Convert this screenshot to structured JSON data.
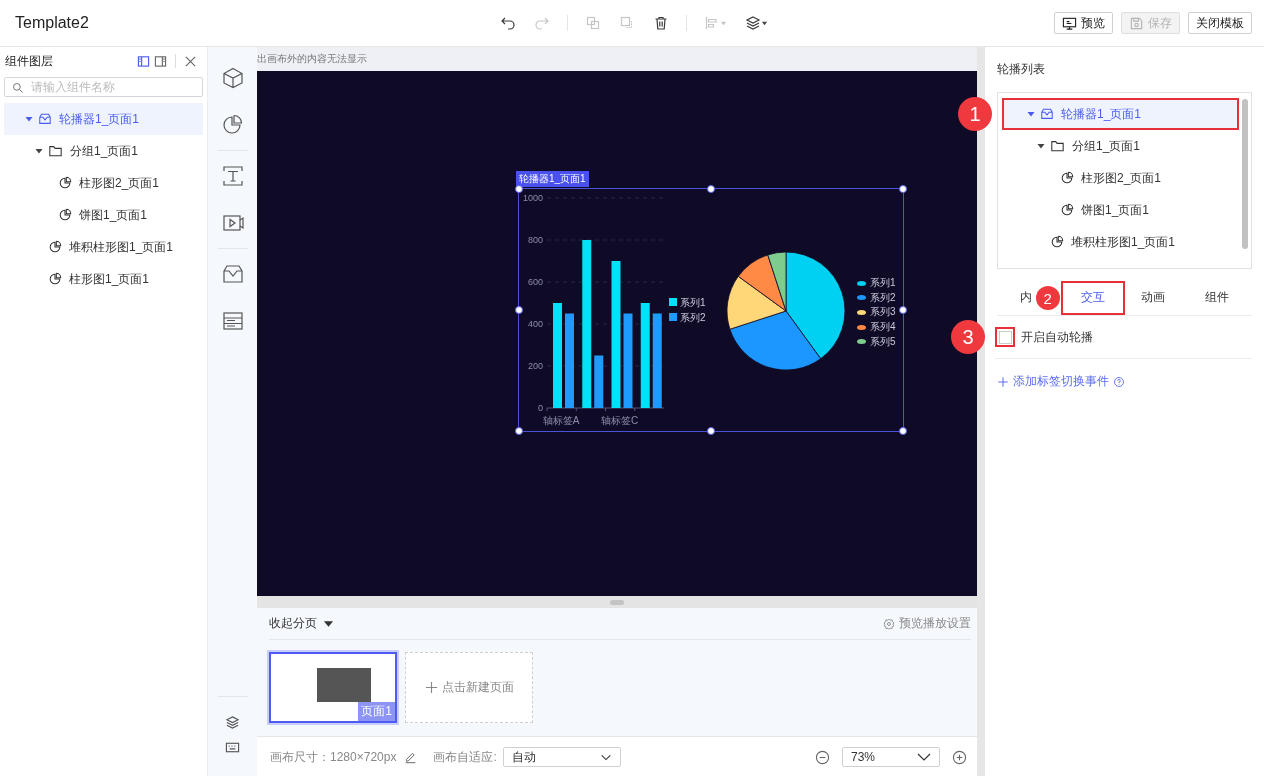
{
  "app_bar": {
    "title": "Template2",
    "toolbar": [
      {
        "kind": "undo",
        "disabled": false
      },
      {
        "kind": "redo",
        "disabled": true
      },
      {
        "kind": "separator"
      },
      {
        "kind": "copy",
        "disabled": true
      },
      {
        "kind": "duplicate",
        "disabled": true
      },
      {
        "kind": "delete",
        "disabled": false
      },
      {
        "kind": "separator"
      },
      {
        "kind": "align",
        "disabled": true
      },
      {
        "kind": "layer",
        "disabled": false
      }
    ],
    "buttons": [
      {
        "kind": "preview",
        "label": "预览",
        "disabled": false
      },
      {
        "kind": "save",
        "label": "保存",
        "disabled": true
      },
      {
        "kind": "close",
        "label": "关闭模板",
        "disabled": false
      }
    ]
  },
  "layers_panel": {
    "title": "组件图层",
    "search": {
      "placeholder": "请输入组件名称"
    },
    "tree": [
      {
        "label": "轮播器1_页面1",
        "kind": "carousel",
        "selected": true,
        "expanded": true,
        "children": [
          {
            "label": "分组1_页面1",
            "kind": "folder",
            "selected": false,
            "expanded": true,
            "children": [
              {
                "label": "柱形图2_页面1",
                "kind": "chart",
                "selected": false
              },
              {
                "label": "饼图1_页面1",
                "kind": "chart",
                "selected": false
              }
            ]
          },
          {
            "label": "堆积柱形图1_页面1",
            "kind": "chart",
            "selected": false
          },
          {
            "label": "柱形图1_页面1",
            "kind": "chart",
            "selected": false
          }
        ]
      }
    ]
  },
  "canvas": {
    "notice": "出画布外的内容无法显示",
    "widget": {
      "label": "轮播器1_页面1",
      "chart_data": {
        "type": "bar",
        "categories": [
          "轴标签A",
          null,
          "轴标签C",
          null
        ],
        "stacked": false,
        "grid": true,
        "legend": true,
        "ylim": [
          0,
          1000
        ],
        "yticks": [
          0,
          200,
          400,
          600,
          800,
          1000
        ],
        "series": [
          {
            "name": "系列1",
            "color": "#00e1fa",
            "values": [
              500,
              800,
              700,
              500
            ]
          },
          {
            "name": "系列2",
            "color": "#1e9bff",
            "values": [
              450,
              250,
              450,
              450
            ]
          }
        ]
      },
      "pie_legend": [
        {
          "label": "系列1",
          "color": "#00d0f2"
        },
        {
          "label": "系列2",
          "color": "#1b97ff"
        },
        {
          "label": "系列3",
          "color": "#ffd778"
        },
        {
          "label": "系列4",
          "color": "#ff8a45"
        },
        {
          "label": "系列5",
          "color": "#7fcc8f"
        }
      ]
    }
  },
  "pages": {
    "toggle": "收起分页",
    "settings": "预览播放设置",
    "items": [
      {
        "label": "页面1",
        "selected": true
      }
    ],
    "new_page": "点击新建页面"
  },
  "footer": {
    "size": "画布尺寸：1280×720px",
    "fit_label": "画布自适应:",
    "fit_value": "自动",
    "zoom": "73%"
  },
  "settings_panel": {
    "title": "轮播列表",
    "tree": [
      {
        "label": "轮播器1_页面1",
        "kind": "carousel",
        "selected": true,
        "expanded": true,
        "callout": "1",
        "children": [
          {
            "label": "分组1_页面1",
            "kind": "folder",
            "selected": false,
            "expanded": true,
            "children": [
              {
                "label": "柱形图2_页面1",
                "kind": "chart",
                "selected": false
              },
              {
                "label": "饼图1_页面1",
                "kind": "chart",
                "selected": false
              }
            ]
          },
          {
            "label": "堆积柱形图1_页面1",
            "kind": "chart",
            "selected": false
          }
        ]
      }
    ],
    "tabs": [
      {
        "label": "内",
        "selected": false
      },
      {
        "label": "交互",
        "selected": true,
        "callout": "2"
      },
      {
        "label": "动画",
        "selected": false
      },
      {
        "label": "组件",
        "selected": false
      }
    ],
    "auto_play": {
      "label": "开启自动轮播",
      "checked": false,
      "callout": "3"
    },
    "add_event": "添加标签切换事件"
  }
}
